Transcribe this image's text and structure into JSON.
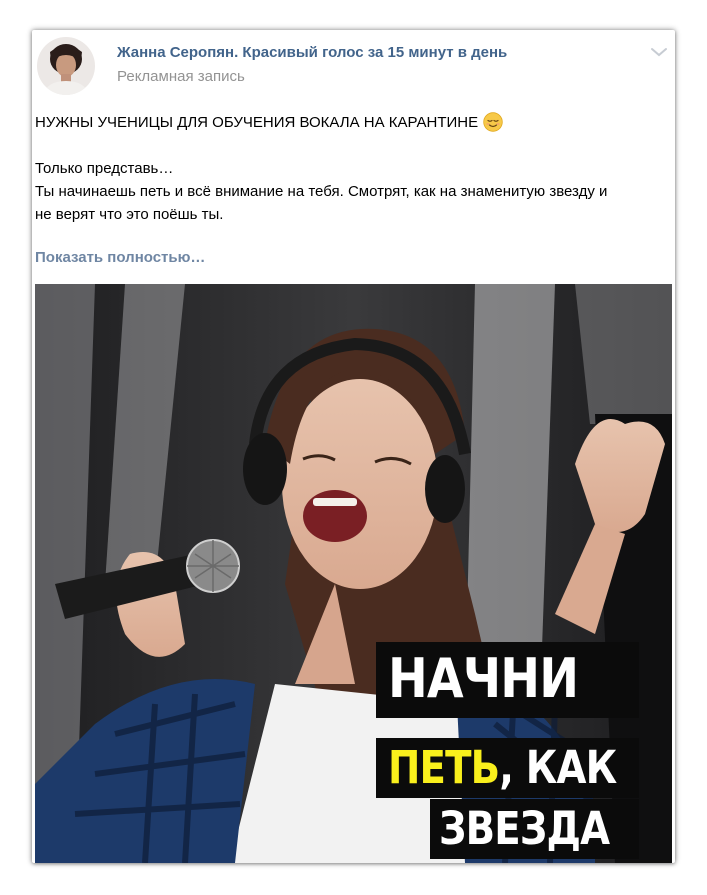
{
  "post": {
    "author_name": "Жанна Серопян. Красивый голос за 15 минут в день",
    "subtitle": "Рекламная запись",
    "headline": "НУЖНЫ УЧЕНИЦЫ ДЛЯ ОБУЧЕНИЯ ВОКАЛА НА КАРАНТИНЕ",
    "headline_emoji": "relieved-face-emoji",
    "body_lines": [
      "Только представь…",
      "Ты начинаешь петь и всё внимание на тебя. Смотрят, как на знаменитую звезду и",
      "не верят что это поёшь ты."
    ],
    "show_more": "Показать полностью…",
    "menu_icon": "chevron-down-icon"
  },
  "image": {
    "banner_line1": "НАЧНИ",
    "banner_line2_highlight": "ПЕТЬ",
    "banner_line2_rest": ", КАК",
    "banner_line3": "ЗВЕЗДА",
    "colors": {
      "highlight": "#f9ef1c",
      "banner_bg": "#0b0b0b",
      "link": "#42648b"
    }
  }
}
